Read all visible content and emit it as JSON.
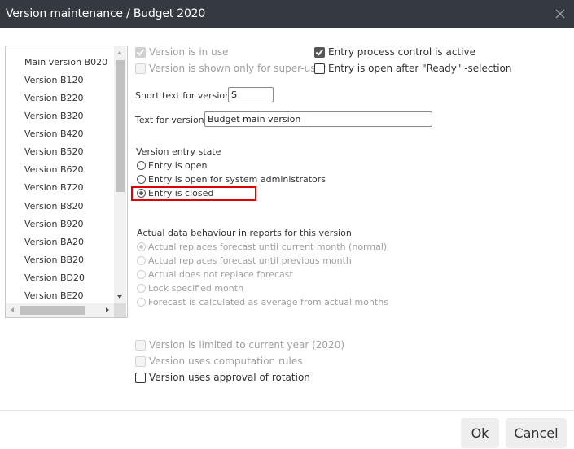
{
  "window": {
    "title": "Version maintenance / Budget 2020",
    "close_icon": "close-x-icon"
  },
  "version_list": {
    "items": [
      "Main version B020",
      "Version B120",
      "Version B220",
      "Version B320",
      "Version B420",
      "Version B520",
      "Version B620",
      "Version B720",
      "Version B820",
      "Version B920",
      "Version BA20",
      "Version BB20",
      "Version BD20",
      "Version BE20"
    ]
  },
  "flags": {
    "version_in_use": {
      "label": "Version is in use",
      "checked": true,
      "enabled": false
    },
    "super_user_only": {
      "label": "Version is shown only for super-user",
      "checked": false,
      "enabled": false
    },
    "entry_process_control": {
      "label": "Entry process control is active",
      "checked": true,
      "enabled": true
    },
    "open_after_ready": {
      "label": "Entry is open after \"Ready\" -selection",
      "checked": false,
      "enabled": true
    }
  },
  "fields": {
    "short_text_label": "Short text for version:",
    "short_text_value": "S",
    "text_label": "Text for version:",
    "text_value": "Budget main version"
  },
  "entry_state": {
    "title": "Version entry state",
    "options": [
      {
        "label": "Entry is open",
        "selected": false
      },
      {
        "label": "Entry is open for system administrators",
        "selected": false
      },
      {
        "label": "Entry is closed",
        "selected": true
      }
    ]
  },
  "actual_behaviour": {
    "title": "Actual data behaviour in reports for this version",
    "options": [
      {
        "label": "Actual replaces forecast until current month (normal)",
        "selected": true
      },
      {
        "label": "Actual replaces forecast until previous month",
        "selected": false
      },
      {
        "label": "Actual does not replace forecast",
        "selected": false
      },
      {
        "label": "Lock specified month",
        "selected": false
      },
      {
        "label": "Forecast is calculated as average from actual months",
        "selected": false
      }
    ]
  },
  "bottom_flags": {
    "limited_current_year": {
      "label": "Version is limited to current year (2020)",
      "checked": false,
      "enabled": false
    },
    "computation_rules": {
      "label": "Version uses computation rules",
      "checked": false,
      "enabled": false
    },
    "approval_rotation": {
      "label": "Version uses approval of rotation",
      "checked": false,
      "enabled": true
    }
  },
  "buttons": {
    "ok": "Ok",
    "cancel": "Cancel"
  },
  "colors": {
    "titlebar": "#353a41",
    "highlight": "#e00000"
  }
}
